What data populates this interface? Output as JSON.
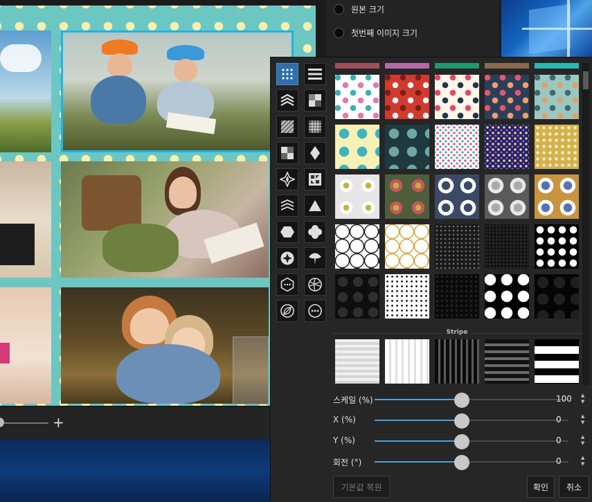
{
  "top_panel": {
    "options": [
      {
        "label": "원본 크기"
      },
      {
        "label": "첫번째 이미지 크기"
      }
    ]
  },
  "zoom": {
    "plus_label": "+"
  },
  "pattern_popup": {
    "categories": [
      {
        "icon": "dots-grid-icon",
        "active": true
      },
      {
        "icon": "horizontal-lines-icon"
      },
      {
        "icon": "chevrons-icon"
      },
      {
        "icon": "checker-quad-icon"
      },
      {
        "icon": "diagonal-lines-icon"
      },
      {
        "icon": "grid-cross-icon"
      },
      {
        "icon": "checker-blocks-icon"
      },
      {
        "icon": "diamond-icon"
      },
      {
        "icon": "star-cross-icon"
      },
      {
        "icon": "tile-pattern-icon"
      },
      {
        "icon": "layered-chevrons-icon"
      },
      {
        "icon": "triangle-icon"
      },
      {
        "icon": "hexagon-icon"
      },
      {
        "icon": "clover-icon"
      },
      {
        "icon": "circle-star-icon"
      },
      {
        "icon": "ginkgo-leaf-icon"
      },
      {
        "icon": "hexagon-dots-icon"
      },
      {
        "icon": "ball-icon"
      },
      {
        "icon": "leaf-icon"
      },
      {
        "icon": "more-icon"
      }
    ],
    "section_label": "Stripe",
    "accent_color": "#4aa3e0",
    "sliders": [
      {
        "label": "스케일 (%)",
        "value": "100",
        "fraction": 0.45
      },
      {
        "label": "X (%)",
        "value": "0",
        "fraction": 0.45
      },
      {
        "label": "Y (%)",
        "value": "0",
        "fraction": 0.45
      },
      {
        "label": "회전 (°)",
        "value": "0",
        "fraction": 0.45
      }
    ],
    "buttons": {
      "reset": "기본값 복원",
      "ok": "확인",
      "cancel": "취소"
    }
  }
}
